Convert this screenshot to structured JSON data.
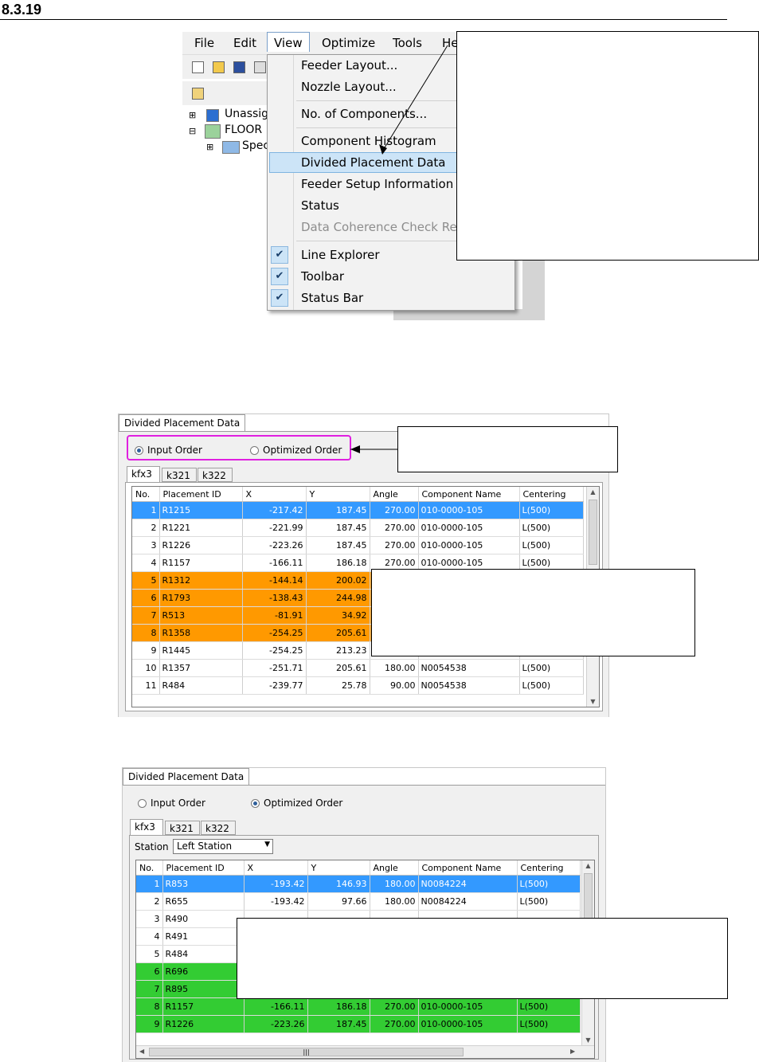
{
  "section_number": "8.3.19",
  "menu_screenshot": {
    "menubar": [
      "File",
      "Edit",
      "View",
      "Optimize",
      "Tools",
      "He"
    ],
    "tree": [
      "Unassig",
      "FLOOR",
      "Spec"
    ],
    "view_menu": {
      "items": [
        "Feeder Layout...",
        "Nozzle Layout...",
        "No. of Components...",
        "Component Histogram",
        "Divided Placement Data",
        "Feeder Setup Information",
        "Status",
        "Data Coherence Check Res",
        "Line Explorer",
        "Toolbar",
        "Status Bar"
      ],
      "highlighted": "Divided Placement Data",
      "disabled": "Data Coherence Check Res",
      "checked": [
        "Line Explorer",
        "Toolbar",
        "Status Bar"
      ]
    }
  },
  "panel_input_order": {
    "title": "Divided Placement Data",
    "radio_input": "Input Order",
    "radio_optimized": "Optimized Order",
    "selected_radio": "Input Order",
    "tabs": [
      "kfx3",
      "k321",
      "k322"
    ],
    "columns": [
      "No.",
      "Placement ID",
      "X",
      "Y",
      "Angle",
      "Component Name",
      "Centering"
    ],
    "rows": [
      [
        "1",
        "R1215",
        "-217.42",
        "187.45",
        "270.00",
        "010-0000-105",
        "L(500)"
      ],
      [
        "2",
        "R1221",
        "-221.99",
        "187.45",
        "270.00",
        "010-0000-105",
        "L(500)"
      ],
      [
        "3",
        "R1226",
        "-223.26",
        "187.45",
        "270.00",
        "010-0000-105",
        "L(500)"
      ],
      [
        "4",
        "R1157",
        "-166.11",
        "186.18",
        "270.00",
        "010-0000-105",
        "L(500)"
      ],
      [
        "5",
        "R1312",
        "-144.14",
        "200.02",
        "",
        "",
        ""
      ],
      [
        "6",
        "R1793",
        "-138.43",
        "244.98",
        "",
        "",
        ""
      ],
      [
        "7",
        "R513",
        "-81.91",
        "34.92",
        "",
        "",
        ""
      ],
      [
        "8",
        "R1358",
        "-254.25",
        "205.61",
        "",
        "",
        ""
      ],
      [
        "9",
        "R1445",
        "-254.25",
        "213.23",
        "",
        "",
        ""
      ],
      [
        "10",
        "R1357",
        "-251.71",
        "205.61",
        "180.00",
        "N0054538",
        "L(500)"
      ],
      [
        "11",
        "R484",
        "-239.77",
        "25.78",
        "90.00",
        "N0054538",
        "L(500)"
      ]
    ]
  },
  "panel_optimized_order": {
    "title": "Divided Placement Data",
    "radio_input": "Input Order",
    "radio_optimized": "Optimized Order",
    "selected_radio": "Optimized Order",
    "tabs": [
      "kfx3",
      "k321",
      "k322"
    ],
    "station_label": "Station",
    "station_value": "Left Station",
    "columns": [
      "No.",
      "Placement ID",
      "X",
      "Y",
      "Angle",
      "Component Name",
      "Centering"
    ],
    "rows": [
      [
        "1",
        "R853",
        "-193.42",
        "146.93",
        "180.00",
        "N0084224",
        "L(500)"
      ],
      [
        "2",
        "R655",
        "-193.42",
        "97.66",
        "180.00",
        "N0084224",
        "L(500)"
      ],
      [
        "3",
        "R490",
        "",
        "",
        "",
        "",
        ""
      ],
      [
        "4",
        "R491",
        "",
        "",
        "",
        "",
        ""
      ],
      [
        "5",
        "R484",
        "",
        "",
        "",
        "",
        ""
      ],
      [
        "6",
        "R696",
        "",
        "",
        "",
        "",
        ""
      ],
      [
        "7",
        "R895",
        "",
        "",
        "",
        "",
        ""
      ],
      [
        "8",
        "R1157",
        "-166.11",
        "186.18",
        "270.00",
        "010-0000-105",
        "L(500)"
      ],
      [
        "9",
        "R1226",
        "-223.26",
        "187.45",
        "270.00",
        "010-0000-105",
        "L(500)"
      ]
    ]
  },
  "colors": {
    "selected_row": "#3399ff",
    "orange_rows": "#ff9900",
    "green_rows": "#33cc33",
    "highlight_frame": "#e020e0",
    "menu_highlight": "#cce4f7"
  }
}
